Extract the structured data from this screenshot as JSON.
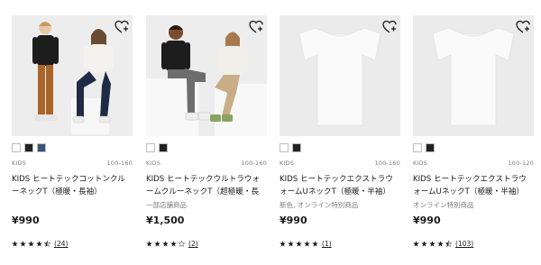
{
  "products": [
    {
      "tag": "KIDS",
      "size_range": "100-160",
      "title": "KIDS ヒートテックコットンクルーネックT（極暖・長袖）",
      "promo": "",
      "price": "¥990",
      "rating": 4.5,
      "review_count": "24",
      "swatches": [
        "#ffffff",
        "#222222",
        "#3a5478"
      ],
      "image": "kids-model-photo"
    },
    {
      "tag": "KIDS",
      "size_range": "100-160",
      "title": "KIDS ヒートテックウルトラウォームクルーネックT（超極暖・長袖）",
      "promo": "一部店舗商品",
      "price": "¥1,500",
      "rating": 4,
      "review_count": "2",
      "swatches": [
        "#ffffff",
        "#222222"
      ],
      "image": "kids-model-photo"
    },
    {
      "tag": "KIDS",
      "size_range": "100-160",
      "title": "KIDS ヒートテックエクストラウォームUネックT（極暖・半袖）",
      "promo": "新色, オンライン特別商品",
      "price": "¥990",
      "rating": 5,
      "review_count": "1",
      "swatches": [
        "#ffffff",
        "#222222"
      ],
      "image": "white-tee-photo"
    },
    {
      "tag": "KIDS",
      "size_range": "100-120",
      "title": "KIDS ヒートテックエクストラウォームUネックT（極暖・半袖）",
      "promo": "オンライン特別商品",
      "price": "¥990",
      "rating": 4.5,
      "review_count": "103",
      "swatches": [
        "#ffffff",
        "#222222"
      ],
      "image": "white-tee-photo"
    }
  ],
  "icons": {
    "favorite": "heart-plus-icon",
    "star": "star-icon"
  },
  "colors": {
    "star": "#1b1b1b",
    "text_muted": "#7a7a7a",
    "photo_bg": "#ececec"
  }
}
